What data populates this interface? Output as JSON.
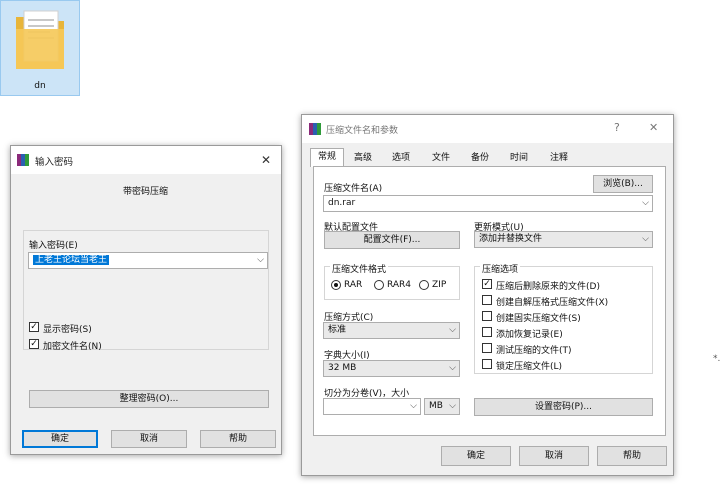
{
  "desktop": {
    "icon_label": "dn"
  },
  "password_dialog": {
    "title": "输入密码",
    "close": "✕",
    "heading": "带密码压缩",
    "password_label": "输入密码(E)",
    "password_value": "上老王论坛当老王",
    "show_password": "显示密码(S)",
    "encrypt_names": "加密文件名(N)",
    "manage_button": "整理密码(O)...",
    "ok": "确定",
    "cancel": "取消",
    "help": "帮助"
  },
  "archive_dialog": {
    "title": "压缩文件名和参数",
    "help_glyph": "?",
    "close": "✕",
    "tabs": [
      "常规",
      "高级",
      "选项",
      "文件",
      "备份",
      "时间",
      "注释"
    ],
    "archive_name_label": "压缩文件名(A)",
    "archive_name_value": "dn.rar",
    "browse_button": "浏览(B)...",
    "default_profile_label": "默认配置文件",
    "profile_button": "配置文件(F)...",
    "update_mode_label": "更新模式(U)",
    "update_mode_value": "添加并替换文件",
    "format_group": "压缩文件格式",
    "format_rar": "RAR",
    "format_rar4": "RAR4",
    "format_zip": "ZIP",
    "method_label": "压缩方式(C)",
    "method_value": "标准",
    "dict_label": "字典大小(I)",
    "dict_value": "32 MB",
    "split_label": "切分为分卷(V)，大小",
    "split_unit": "MB",
    "options_group": "压缩选项",
    "options": [
      "压缩后删除原来的文件(D)",
      "创建自解压格式压缩文件(X)",
      "创建固实压缩文件(S)",
      "添加恢复记录(E)",
      "测试压缩的文件(T)",
      "锁定压缩文件(L)"
    ],
    "set_password_button": "设置密码(P)...",
    "ok": "确定",
    "cancel": "取消",
    "help": "帮助"
  },
  "stray_text": "*."
}
